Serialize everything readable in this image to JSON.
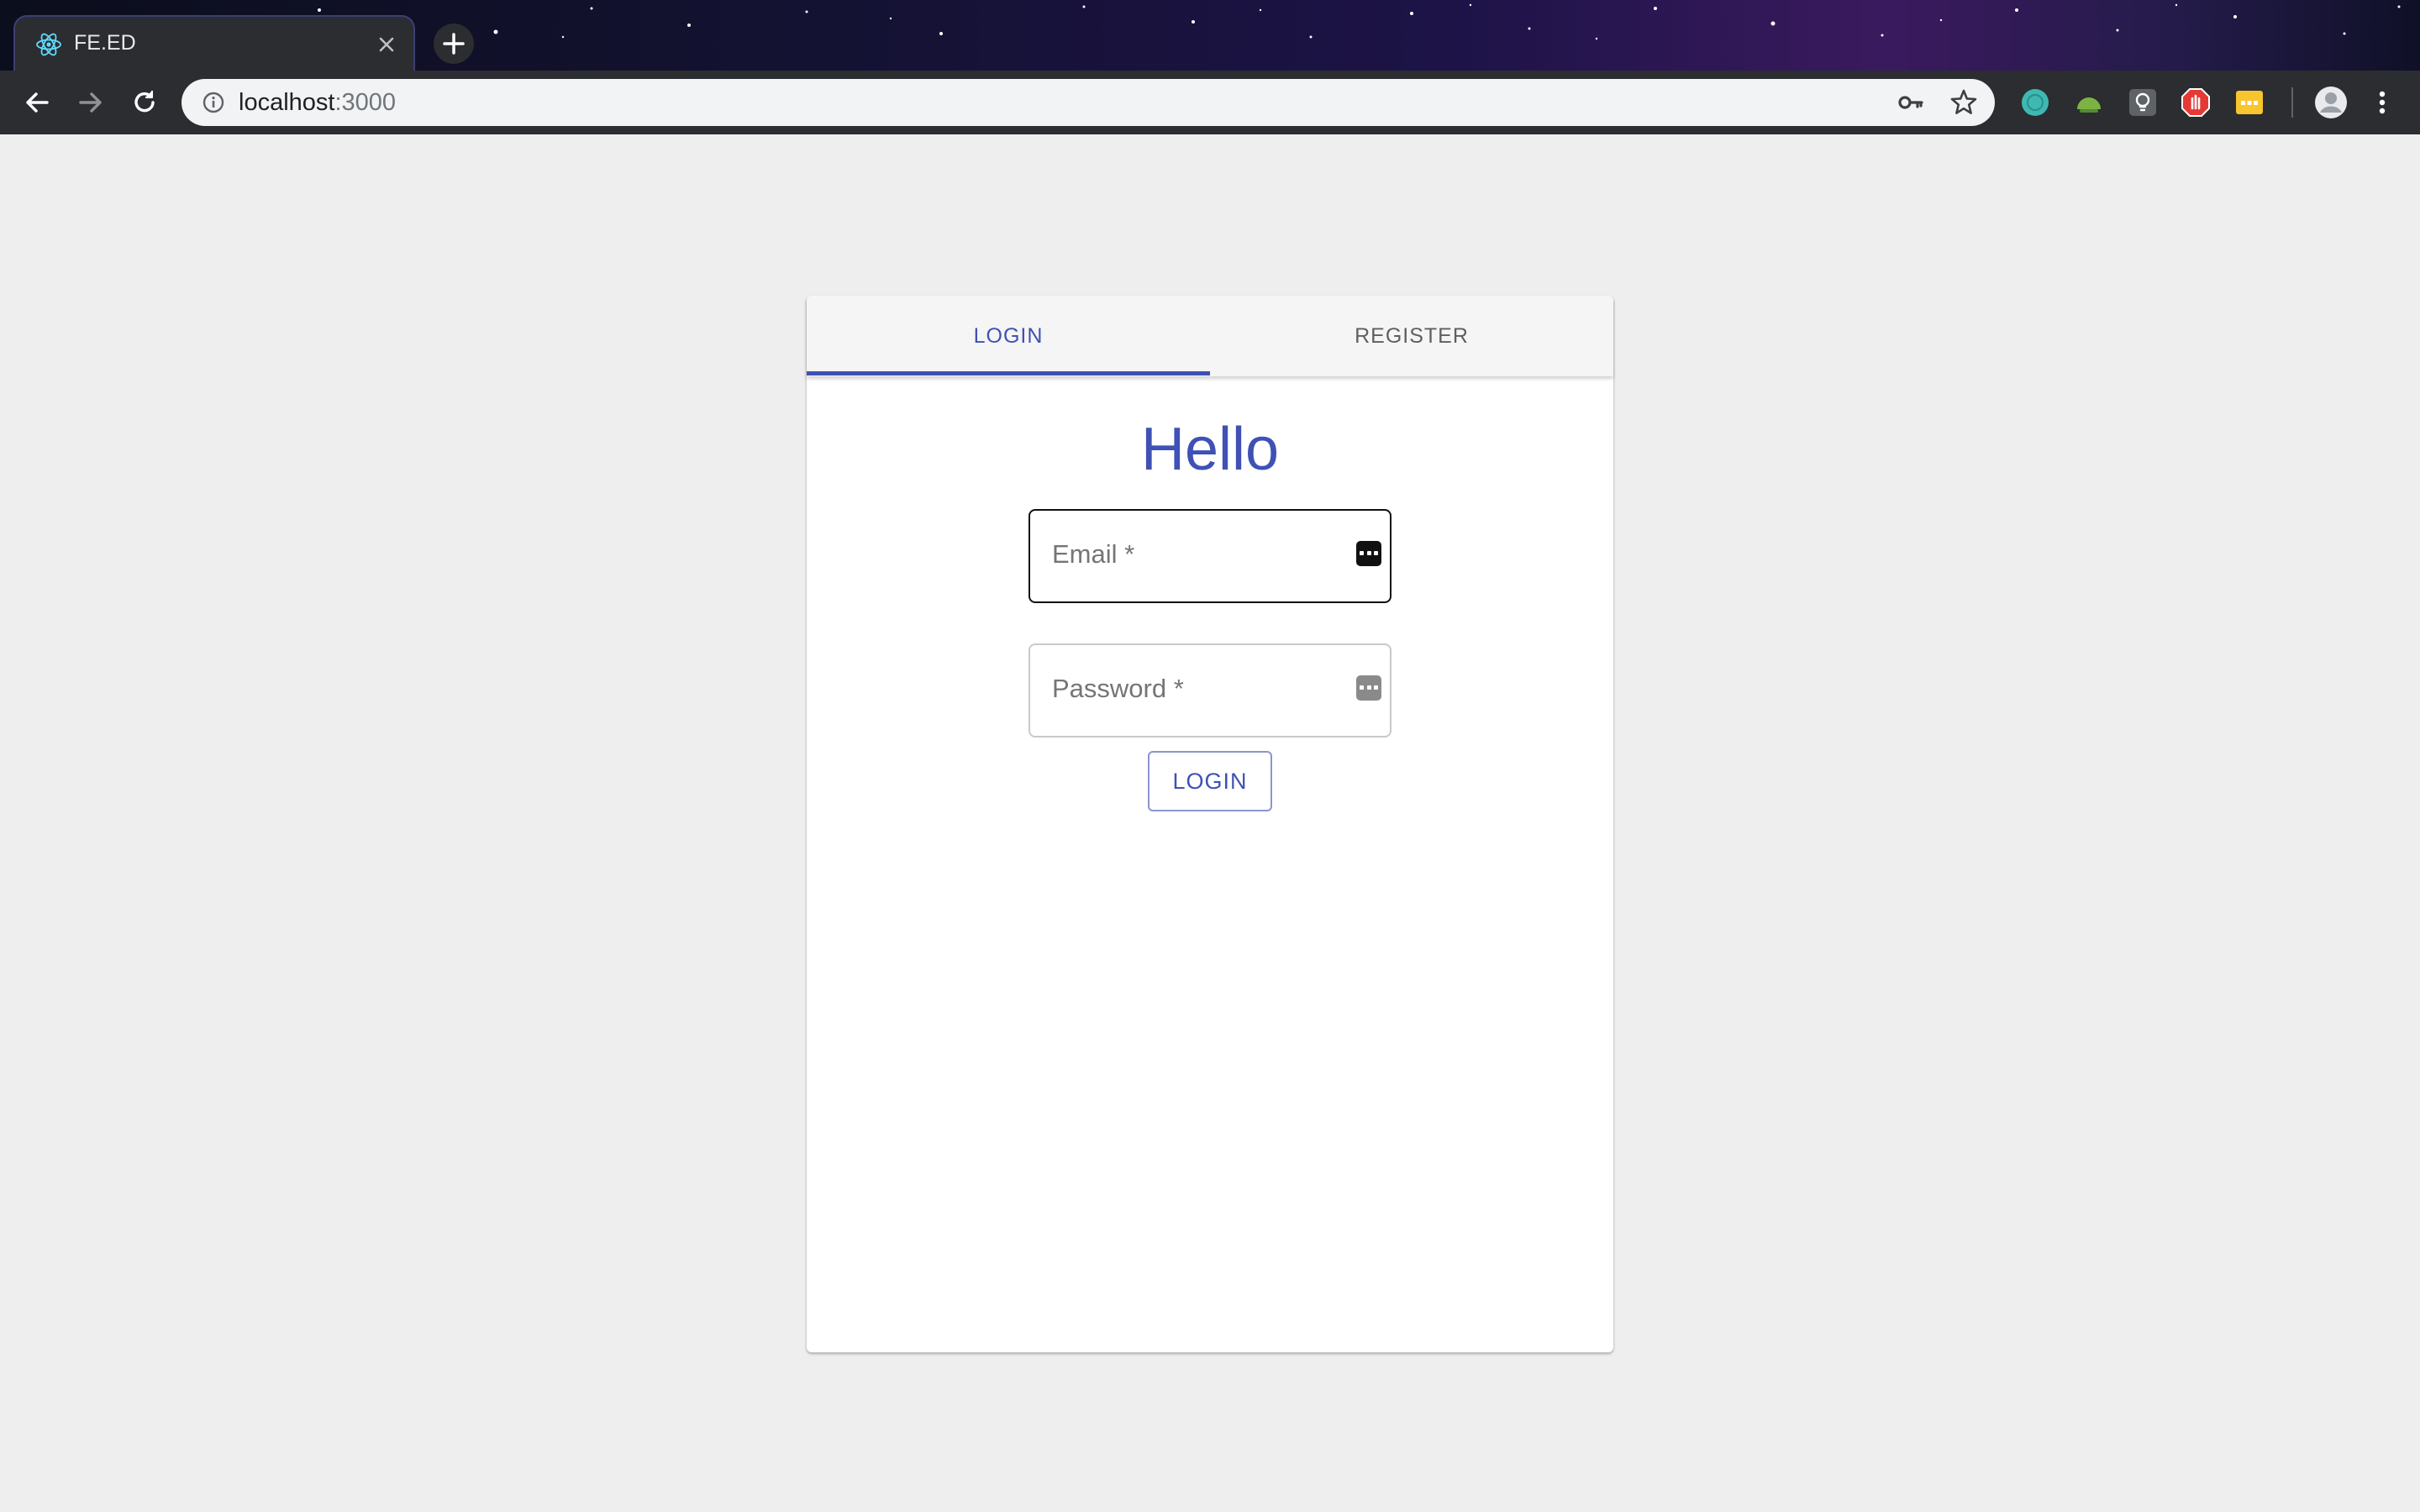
{
  "browser": {
    "tab_title": "FE.ED",
    "url_host": "localhost",
    "url_port": ":3000",
    "icons": {
      "tab_favicon": "react-atom-icon",
      "close": "close-icon",
      "new_tab": "plus-icon",
      "back": "arrow-left-icon",
      "forward": "arrow-right-icon",
      "reload": "reload-icon",
      "site_info": "info-icon",
      "password": "key-icon",
      "bookmark": "star-icon",
      "profile": "avatar-icon",
      "menu": "kebab-menu-icon"
    },
    "extensions": [
      "teal-circle-extension-icon",
      "green-dome-extension-icon",
      "lightbulb-extension-icon",
      "red-hand-extension-icon",
      "yellow-dots-extension-icon"
    ]
  },
  "auth": {
    "tabs": [
      {
        "label": "LOGIN",
        "active": true
      },
      {
        "label": "REGISTER",
        "active": false
      }
    ],
    "heading": "Hello",
    "email_label": "Email *",
    "password_label": "Password *",
    "submit_label": "LOGIN"
  },
  "colors": {
    "primary": "#3f51b5",
    "page_background": "#eeeeee",
    "card_background": "#ffffff"
  }
}
